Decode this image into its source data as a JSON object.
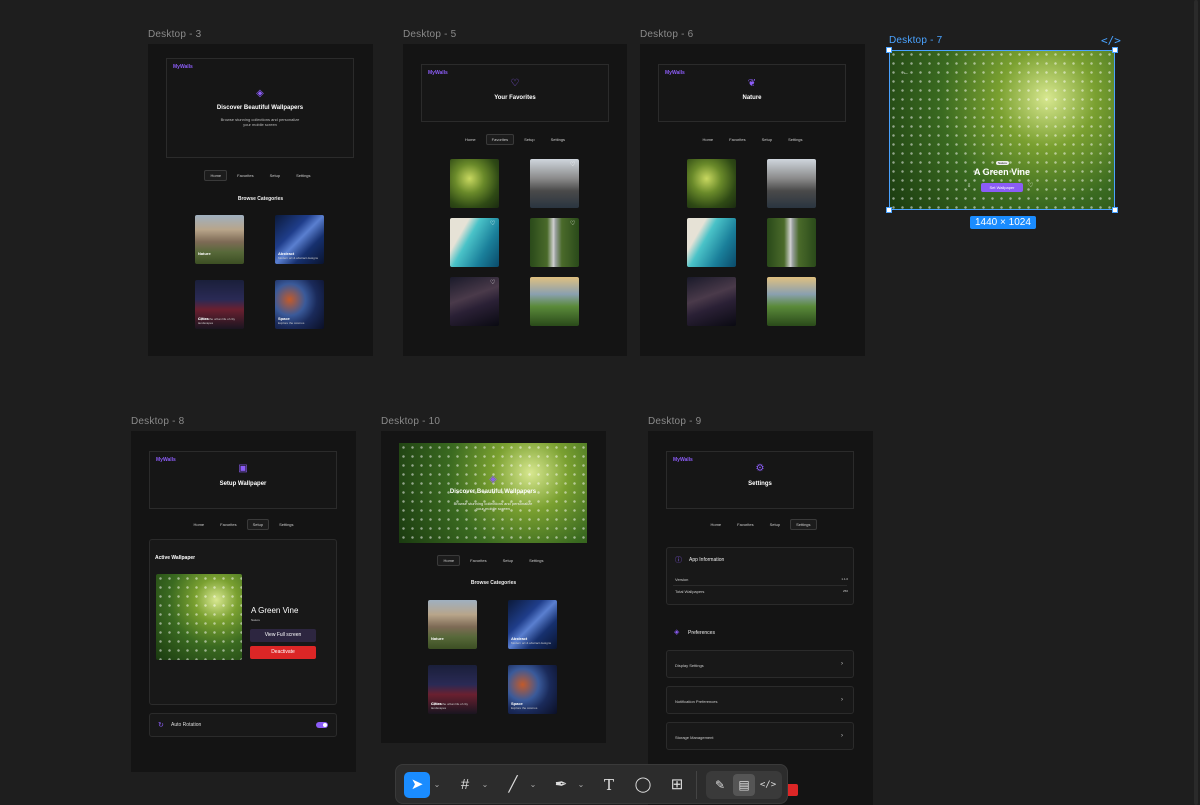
{
  "frames": {
    "d3": "Desktop - 3",
    "d5": "Desktop - 5",
    "d6": "Desktop - 6",
    "d7": "Desktop - 7",
    "d8": "Desktop - 8",
    "d10": "Desktop - 10",
    "d9": "Desktop - 9"
  },
  "app": {
    "brand": "MyWalls"
  },
  "nav": {
    "home": "Home",
    "favorites": "Favorites",
    "setup": "Setup",
    "settings": "Settings"
  },
  "home": {
    "title": "Discover Beautiful Wallpapers",
    "subtitle_line1": "Browse stunning collections and personalize",
    "subtitle_line2": "your mobile screen",
    "section": "Browse Categories"
  },
  "categories": [
    {
      "name": "Nature",
      "desc": ""
    },
    {
      "name": "Abstract",
      "desc": "Modern art & abstract designs"
    },
    {
      "name": "Cities",
      "desc": "Explore the urban life of city landscapes"
    },
    {
      "name": "Space",
      "desc": "Explore the cosmos"
    }
  ],
  "favorites": {
    "title": "Your Favorites"
  },
  "nature": {
    "title": "Nature"
  },
  "detail": {
    "tag": "Nature",
    "title": "A Green Vine",
    "button": "Set Wallpaper",
    "size_badge": "1440 × 1024"
  },
  "setup": {
    "title": "Setup Wallpaper",
    "active_label": "Active Wallpaper",
    "wallpaper_name": "A Green Vine",
    "wallpaper_category": "Nature",
    "view_button": "View Full screen",
    "deactivate_button": "Deactivate",
    "auto_rotation": "Auto Rotation"
  },
  "settings": {
    "title": "Settings",
    "app_info": "App Information",
    "version_label": "Version",
    "version_value": "1.1.0",
    "total_label": "Total Wallpapers",
    "total_value": "256",
    "preferences": "Preferences",
    "items": [
      "Display Settings",
      "Notification Preferences",
      "Storage Management"
    ]
  },
  "colors": {
    "accent": "#8b5cf6",
    "selection": "#1a8cff",
    "danger": "#dc2626",
    "canvas": "#1e1e1e"
  },
  "toolbar_icons": [
    "move-tool-icon",
    "frame-tool-icon",
    "line-tool-icon",
    "pen-tool-icon",
    "text-tool-icon",
    "comment-tool-icon",
    "actions-icon",
    "draw-mode-icon",
    "design-mode-icon",
    "dev-mode-icon"
  ]
}
